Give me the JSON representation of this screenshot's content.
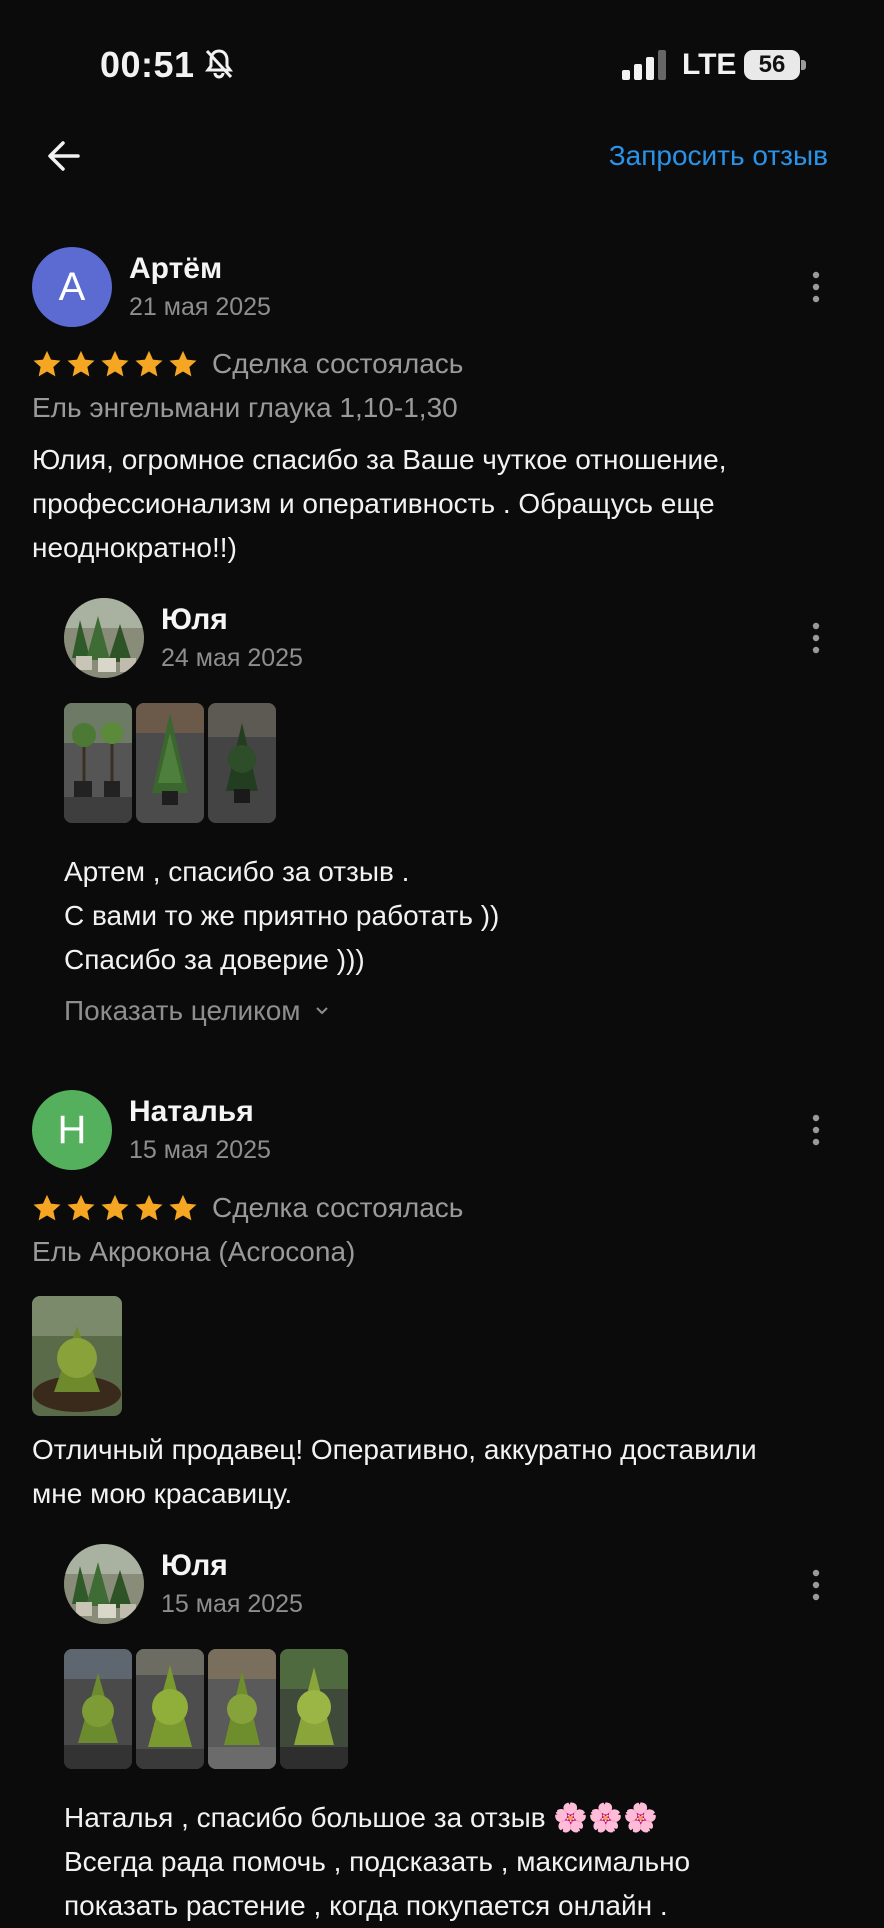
{
  "status": {
    "time": "00:51",
    "network": "LTE",
    "battery": "56"
  },
  "header": {
    "request_label": "Запросить отзыв"
  },
  "reviews": [
    {
      "avatar_letter": "А",
      "avatar_color": "#5b6bd1",
      "name": "Артём",
      "date": "21 мая 2025",
      "deal": "Сделка состоялась",
      "product": "Ель энгельмани глаука 1,10-1,30",
      "text_lines": [
        "Юлия, огромное спасибо за Ваше чуткое отношение,",
        "профессионализм и оперативность . Обращусь еще",
        "неоднократно!!)"
      ],
      "reply": {
        "name": "Юля",
        "date": "24 мая 2025",
        "text_lines": [
          "Артем , спасибо за отзыв .",
          "С вами то же приятно работать ))",
          "Спасибо за доверие )))"
        ],
        "show_all": "Показать целиком"
      }
    },
    {
      "avatar_letter": "Н",
      "avatar_color": "#54b05c",
      "name": "Наталья",
      "date": "15 мая 2025",
      "deal": "Сделка состоялась",
      "product": "Ель Акрокона (Acrocona)",
      "text_lines": [
        "Отличный продавец! Оперативно, аккуратно доставили",
        "мне мою красавицу."
      ],
      "reply": {
        "name": "Юля",
        "date": "15 мая 2025",
        "text_lines": [
          "Наталья , спасибо большое за отзыв 🌸🌸🌸",
          "Всегда рада помочь , подсказать , максимально",
          "показать растение , когда покупается онлайн ."
        ]
      }
    }
  ],
  "colors": {
    "accent": "#2a93e8",
    "star": "#f5a623"
  }
}
